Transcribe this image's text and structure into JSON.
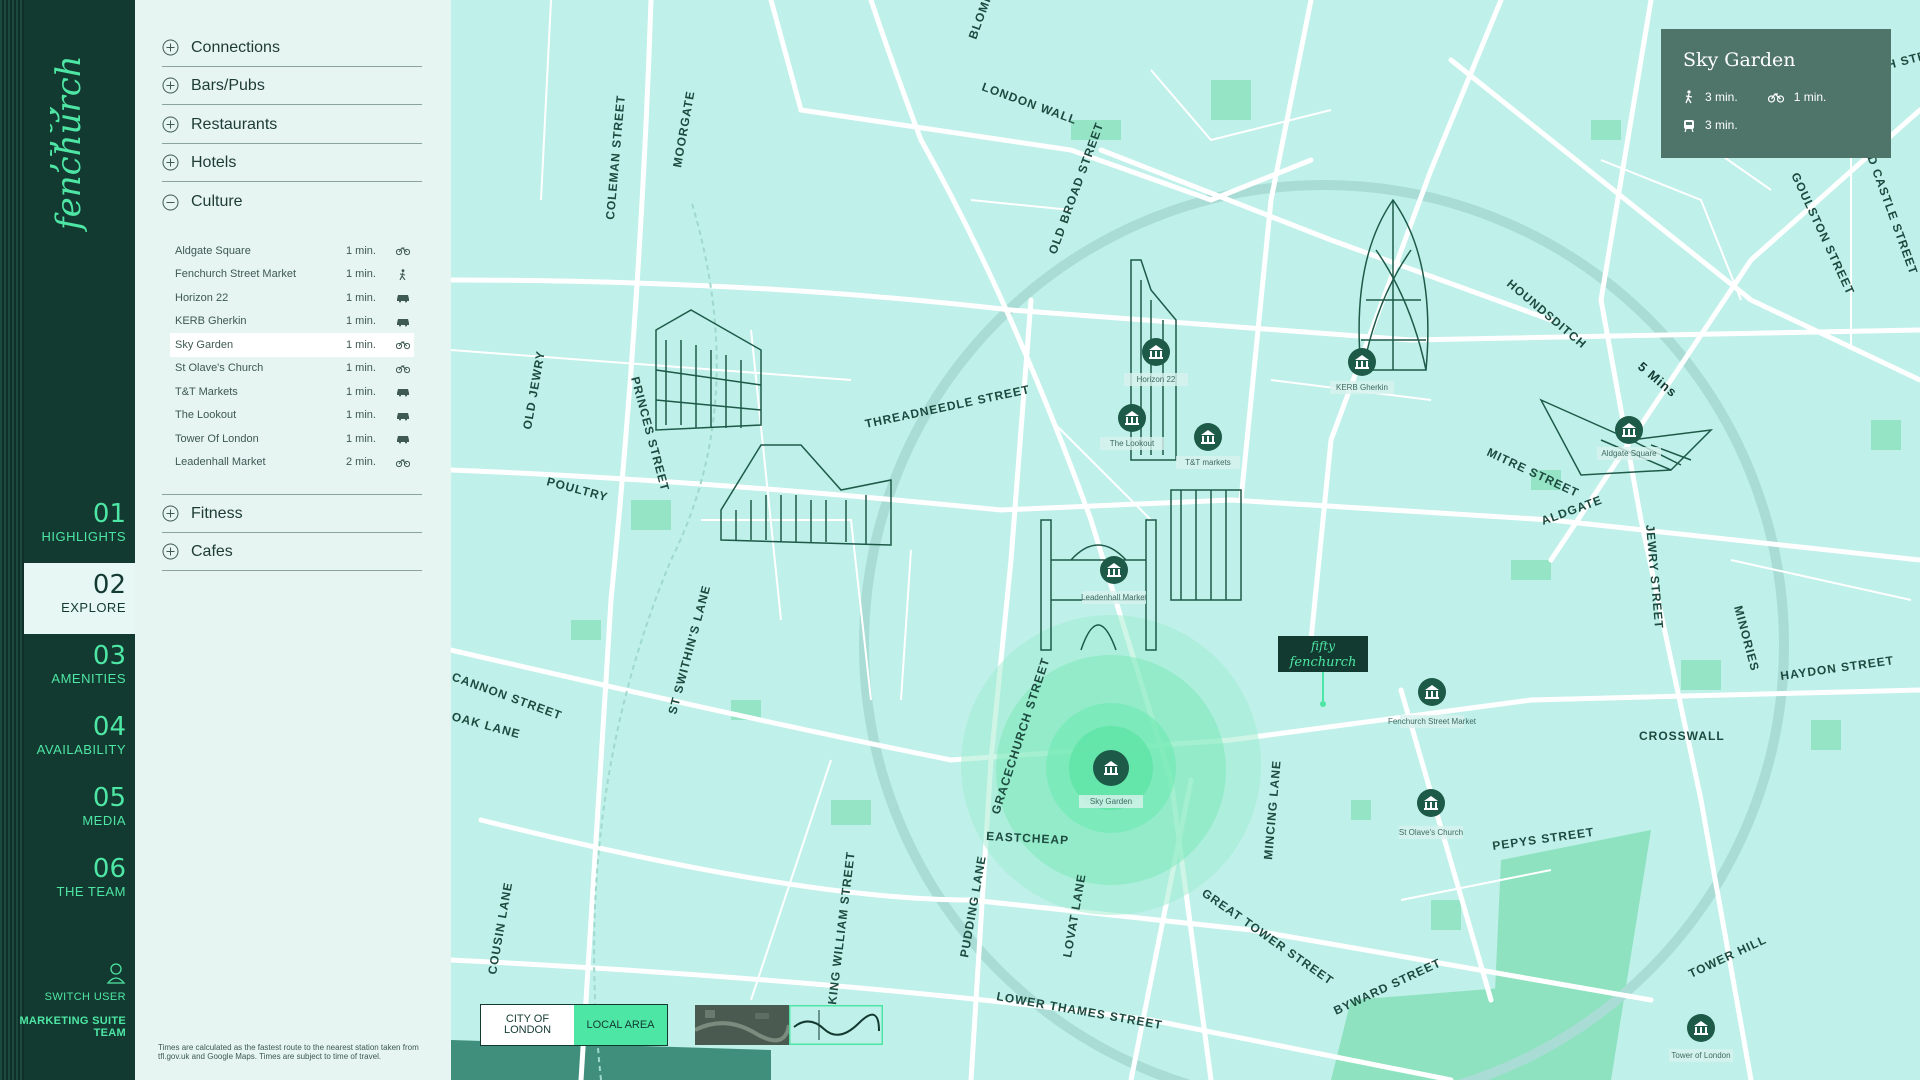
{
  "brand": {
    "logo_text": "fifty fenchurch",
    "accent": "#4ee6a4",
    "dark": "#133a31"
  },
  "nav": {
    "items": [
      {
        "num": "01",
        "label": "HIGHLIGHTS"
      },
      {
        "num": "02",
        "label": "EXPLORE"
      },
      {
        "num": "03",
        "label": "AMENITIES"
      },
      {
        "num": "04",
        "label": "AVAILABILITY"
      },
      {
        "num": "05",
        "label": "MEDIA"
      },
      {
        "num": "06",
        "label": "THE TEAM"
      }
    ],
    "active_index": 1,
    "switch_user": "SWITCH USER",
    "team": "MARKETING SUITE TEAM"
  },
  "panel": {
    "categories": [
      {
        "label": "Connections",
        "expanded": false
      },
      {
        "label": "Bars/Pubs",
        "expanded": false
      },
      {
        "label": "Restaurants",
        "expanded": false
      },
      {
        "label": "Hotels",
        "expanded": false
      },
      {
        "label": "Culture",
        "expanded": true
      },
      {
        "label": "Fitness",
        "expanded": false
      },
      {
        "label": "Cafes",
        "expanded": false
      }
    ],
    "culture_items": [
      {
        "name": "Aldgate Square",
        "time": "1 min.",
        "mode": "bike-icon"
      },
      {
        "name": "Fenchurch Street Market",
        "time": "1 min.",
        "mode": "walk-icon"
      },
      {
        "name": "Horizon 22",
        "time": "1 min.",
        "mode": "car-icon"
      },
      {
        "name": "KERB Gherkin",
        "time": "1 min.",
        "mode": "car-icon"
      },
      {
        "name": "Sky Garden",
        "time": "1 min.",
        "mode": "bike-icon",
        "selected": true
      },
      {
        "name": "St Olave's Church",
        "time": "1 min.",
        "mode": "bike-icon"
      },
      {
        "name": "T&T Markets",
        "time": "1 min.",
        "mode": "car-icon"
      },
      {
        "name": "The Lookout",
        "time": "1 min.",
        "mode": "car-icon"
      },
      {
        "name": "Tower Of London",
        "time": "1 min.",
        "mode": "car-icon"
      },
      {
        "name": "Leadenhall Market",
        "time": "2 min.",
        "mode": "bike-icon"
      }
    ],
    "footnote": "Times are calculated as the fastest route to the nearest station taken from tfl.gov.uk and Google Maps. Times are subject to time of travel."
  },
  "info_card": {
    "title": "Sky Garden",
    "walk": "3 min.",
    "bike": "1 min.",
    "train": "3 min."
  },
  "map": {
    "streets": [
      "LONDON WALL",
      "BLOMFIELD",
      "COLEMAN STREET",
      "MOORGATE",
      "OLD BROAD STREET",
      "HOUNDSDITCH",
      "GOULSTON STREET",
      "OLD CASTLE STREET",
      "WENTWORTH STREET",
      "5 Mins",
      "OLD JEWRY",
      "PRINCES STREET",
      "THREADNEEDLE STREET",
      "POULTRY",
      "MITRE STREET",
      "ALDGATE",
      "JEWRY STREET",
      "MINORIES",
      "HAYDON STREET",
      "CROSSWALL",
      "CANNON STREET",
      "OAK LANE",
      "ST SWITHIN'S LANE",
      "GRACECHURCH STREET",
      "EASTCHEAP",
      "MINCING LANE",
      "PEPYS STREET",
      "GREAT TOWER STREET",
      "COUSIN LANE",
      "KING WILLIAM STREET",
      "PUDDING LANE",
      "LOVAT LANE",
      "LOWER THAMES STREET",
      "BYWARD STREET",
      "TOWER HILL"
    ],
    "pins": [
      "Horizon 22",
      "The Lookout",
      "T&T markets",
      "KERB Gherkin",
      "Aldgate Square",
      "Leadenhall Market",
      "Sky Garden",
      "Fenchurch Street Market",
      "St Olave's Church",
      "Tower of London"
    ],
    "marker": "fifty fenchurch"
  },
  "map_toggle": {
    "city": "CITY OF LONDON",
    "local": "LOCAL AREA"
  }
}
